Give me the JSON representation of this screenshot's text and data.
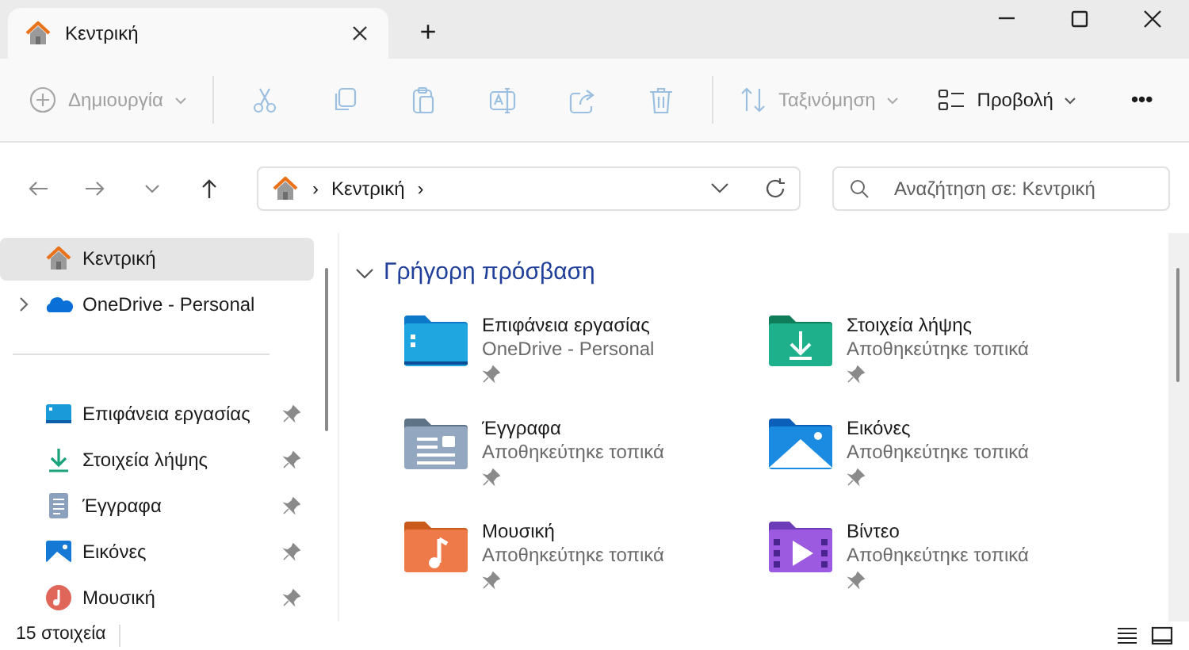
{
  "window": {
    "tab_title": "Κεντρική",
    "new_tab": "+"
  },
  "toolbar": [
    {
      "kind": "new",
      "label": "Δημιουργία",
      "disabled": true
    },
    {
      "kind": "separator"
    },
    {
      "kind": "cut",
      "disabled": true
    },
    {
      "kind": "copy",
      "disabled": true
    },
    {
      "kind": "paste",
      "disabled": true
    },
    {
      "kind": "rename",
      "disabled": true
    },
    {
      "kind": "share",
      "disabled": true
    },
    {
      "kind": "delete",
      "disabled": true
    },
    {
      "kind": "separator"
    },
    {
      "kind": "sort",
      "label": "Ταξινόμηση",
      "disabled": true
    },
    {
      "kind": "view",
      "label": "Προβολή",
      "disabled": false
    },
    {
      "kind": "more",
      "label": "•••",
      "disabled": false
    }
  ],
  "address_bar": {
    "segment": "Κεντρική",
    "separator": "›"
  },
  "search": {
    "placeholder": "Αναζήτηση σε: Κεντρική"
  },
  "sidebar": {
    "items": [
      {
        "kind": "home",
        "label": "Κεντρική",
        "selected": true,
        "expander": false,
        "pinned": false
      },
      {
        "kind": "onedrive",
        "label": "OneDrive - Personal",
        "selected": false,
        "expander": true,
        "pinned": false
      },
      {
        "kind": "divider"
      },
      {
        "kind": "desktop",
        "label": "Επιφάνεια εργασίας",
        "selected": false,
        "expander": false,
        "pinned": true
      },
      {
        "kind": "downloads",
        "label": "Στοιχεία λήψης",
        "selected": false,
        "expander": false,
        "pinned": true
      },
      {
        "kind": "documents",
        "label": "Έγγραφα",
        "selected": false,
        "expander": false,
        "pinned": true
      },
      {
        "kind": "pictures",
        "label": "Εικόνες",
        "selected": false,
        "expander": false,
        "pinned": true
      },
      {
        "kind": "music",
        "label": "Μουσική",
        "selected": false,
        "expander": false,
        "pinned": true
      }
    ]
  },
  "quick_access": {
    "title": "Γρήγορη πρόσβαση",
    "expanded": true,
    "items": [
      {
        "kind": "desktop",
        "name": "Επιφάνεια εργασίας",
        "location": "OneDrive - Personal",
        "pinned": true
      },
      {
        "kind": "downloads",
        "name": "Στοιχεία λήψης",
        "location": "Αποθηκεύτηκε τοπικά",
        "pinned": true
      },
      {
        "kind": "documents",
        "name": "Έγγραφα",
        "location": "Αποθηκεύτηκε τοπικά",
        "pinned": true
      },
      {
        "kind": "pictures",
        "name": "Εικόνες",
        "location": "Αποθηκεύτηκε τοπικά",
        "pinned": true
      },
      {
        "kind": "music",
        "name": "Μουσική",
        "location": "Αποθηκεύτηκε τοπικά",
        "pinned": true
      },
      {
        "kind": "videos",
        "name": "Βίντεο",
        "location": "Αποθηκεύτηκε τοπικά",
        "pinned": true
      }
    ]
  },
  "status_bar": {
    "count": "15 στοιχεία"
  }
}
